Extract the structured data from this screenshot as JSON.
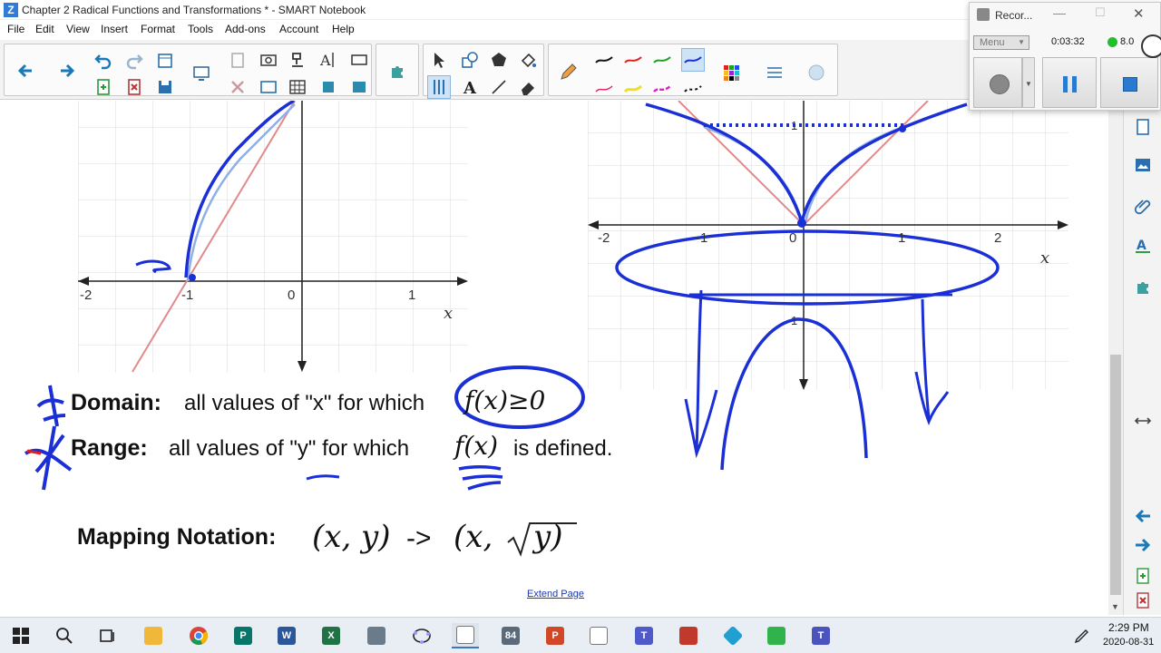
{
  "window": {
    "title": "Chapter 2 Radical Functions and Transformations * - SMART Notebook"
  },
  "menu": [
    "File",
    "Edit",
    "View",
    "Insert",
    "Format",
    "Tools",
    "Add-ons",
    "Account",
    "Help"
  ],
  "recorder": {
    "title": "Recor...",
    "menu_label": "Menu",
    "time": "0:03:32",
    "status_value": "8.0"
  },
  "graph_left": {
    "x_ticks": [
      "-2",
      "-1",
      "0",
      "1"
    ],
    "x_label": "x"
  },
  "graph_right": {
    "x_ticks": [
      "-2",
      "-1",
      "0",
      "1",
      "2"
    ],
    "y_ticks": [
      "1",
      "1"
    ],
    "x_label": "x"
  },
  "notes": {
    "domain_label": "Domain:",
    "domain_text": "all values of \"x\" for which",
    "domain_expr": "f(x)≥0",
    "range_label": "Range:",
    "range_text": "all values of \"y\" for which",
    "range_expr": "f(x)",
    "range_tail": "is defined.",
    "mapping_label": "Mapping Notation:",
    "mapping_left": "(x, y)",
    "mapping_arrow": "->",
    "mapping_right_open": "(x,",
    "mapping_right_y": "y)",
    "extend_page": "Extend Page"
  },
  "clock": {
    "time": "2:29 PM",
    "date": "2020-08-31"
  },
  "colors": {
    "ink_blue": "#1a2fd6",
    "graph_red": "#e08a8a",
    "graph_light_blue": "#8fb0e6"
  },
  "icons": {
    "toolbar": [
      "back-arrow",
      "forward-arrow",
      "undo",
      "redo",
      "paste",
      "screen-capture",
      "camera",
      "table",
      "text-format",
      "shape",
      "add-on",
      "select-pointer",
      "shape-tool",
      "fill",
      "eraser",
      "pen",
      "line",
      "magic-pen"
    ],
    "sidebar": [
      "page-sorter",
      "gallery",
      "attachments",
      "properties",
      "add-ons",
      "expand",
      "prev-page",
      "next-page",
      "add-page",
      "delete-page"
    ]
  }
}
